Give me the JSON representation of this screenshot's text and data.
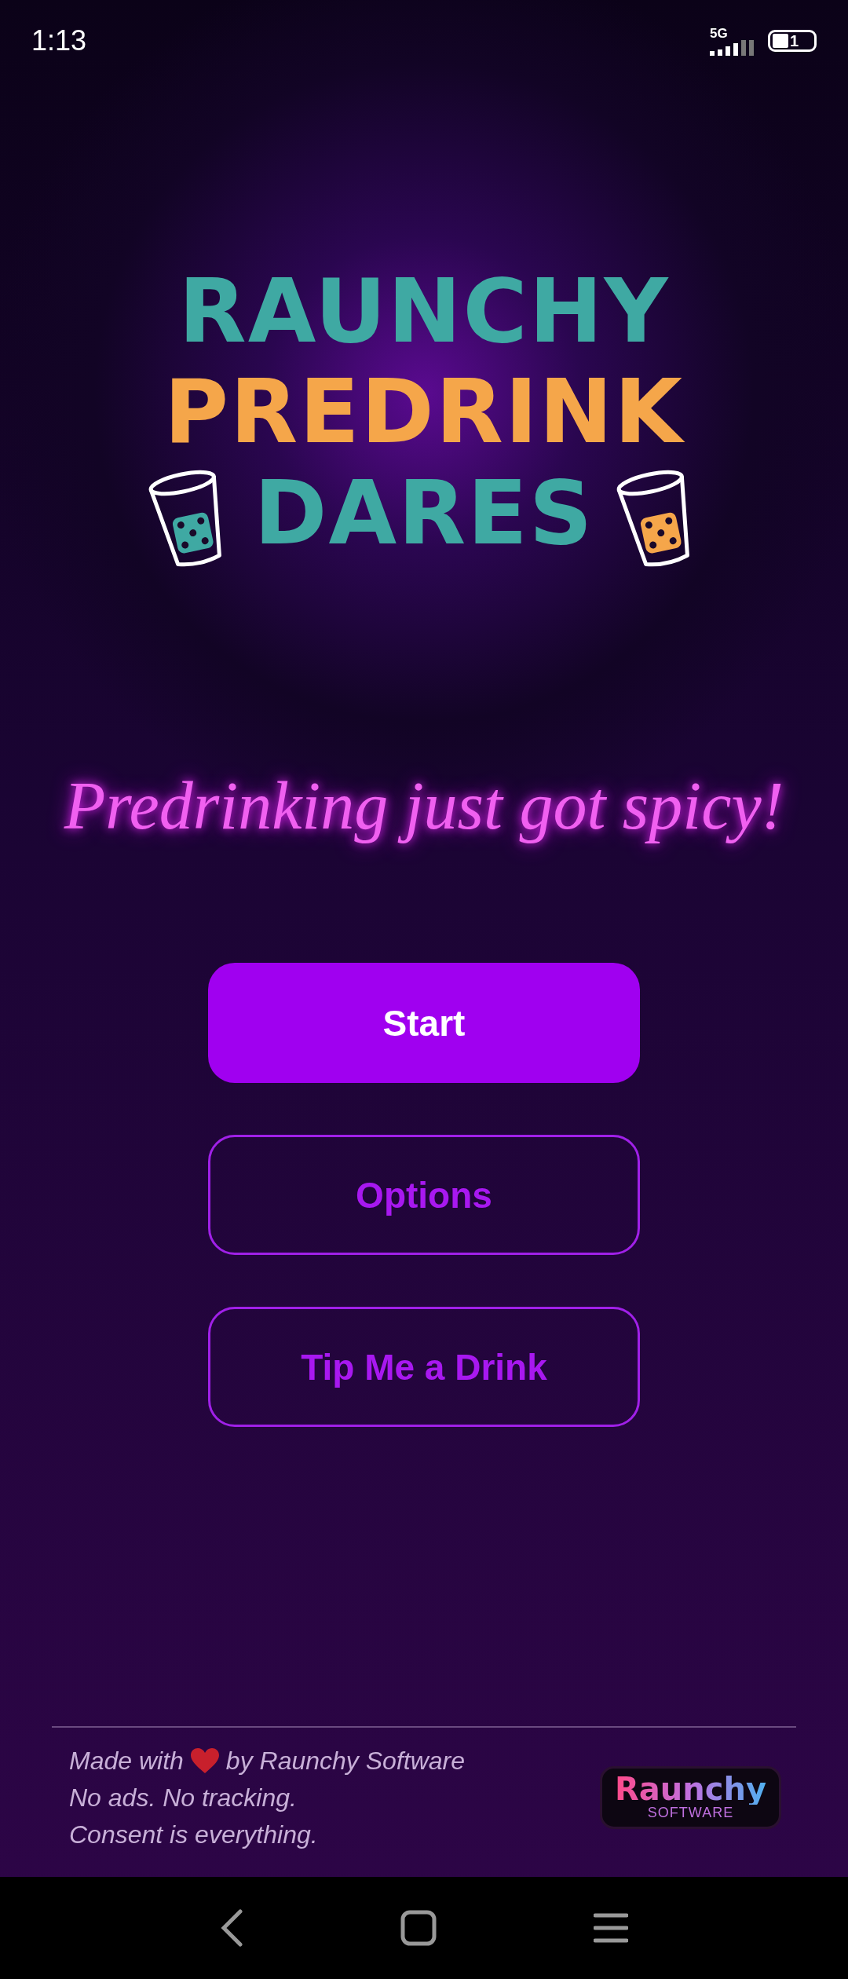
{
  "status_bar": {
    "time": "1:13",
    "network": "5G",
    "battery": "1"
  },
  "logo": {
    "lines": [
      {
        "text": "RAUNCHY",
        "color": "#3fa9a3"
      },
      {
        "text": "PREDRINK",
        "color": "#f5a64a"
      },
      {
        "text": "DARES",
        "color": "#3fa9a3"
      }
    ]
  },
  "tagline": "Predrinking just got spicy!",
  "buttons": [
    {
      "label": "Start",
      "kind": "filled"
    },
    {
      "label": "Options",
      "kind": "outlined"
    },
    {
      "label": "Tip Me a Drink",
      "kind": "outlined"
    }
  ],
  "footer": {
    "made_with": "Made with",
    "by": "by Raunchy Software",
    "lines": [
      "No ads. No tracking.",
      "Consent is everything."
    ],
    "brand": {
      "title": "Raunchy",
      "subtitle": "SOFTWARE"
    }
  }
}
